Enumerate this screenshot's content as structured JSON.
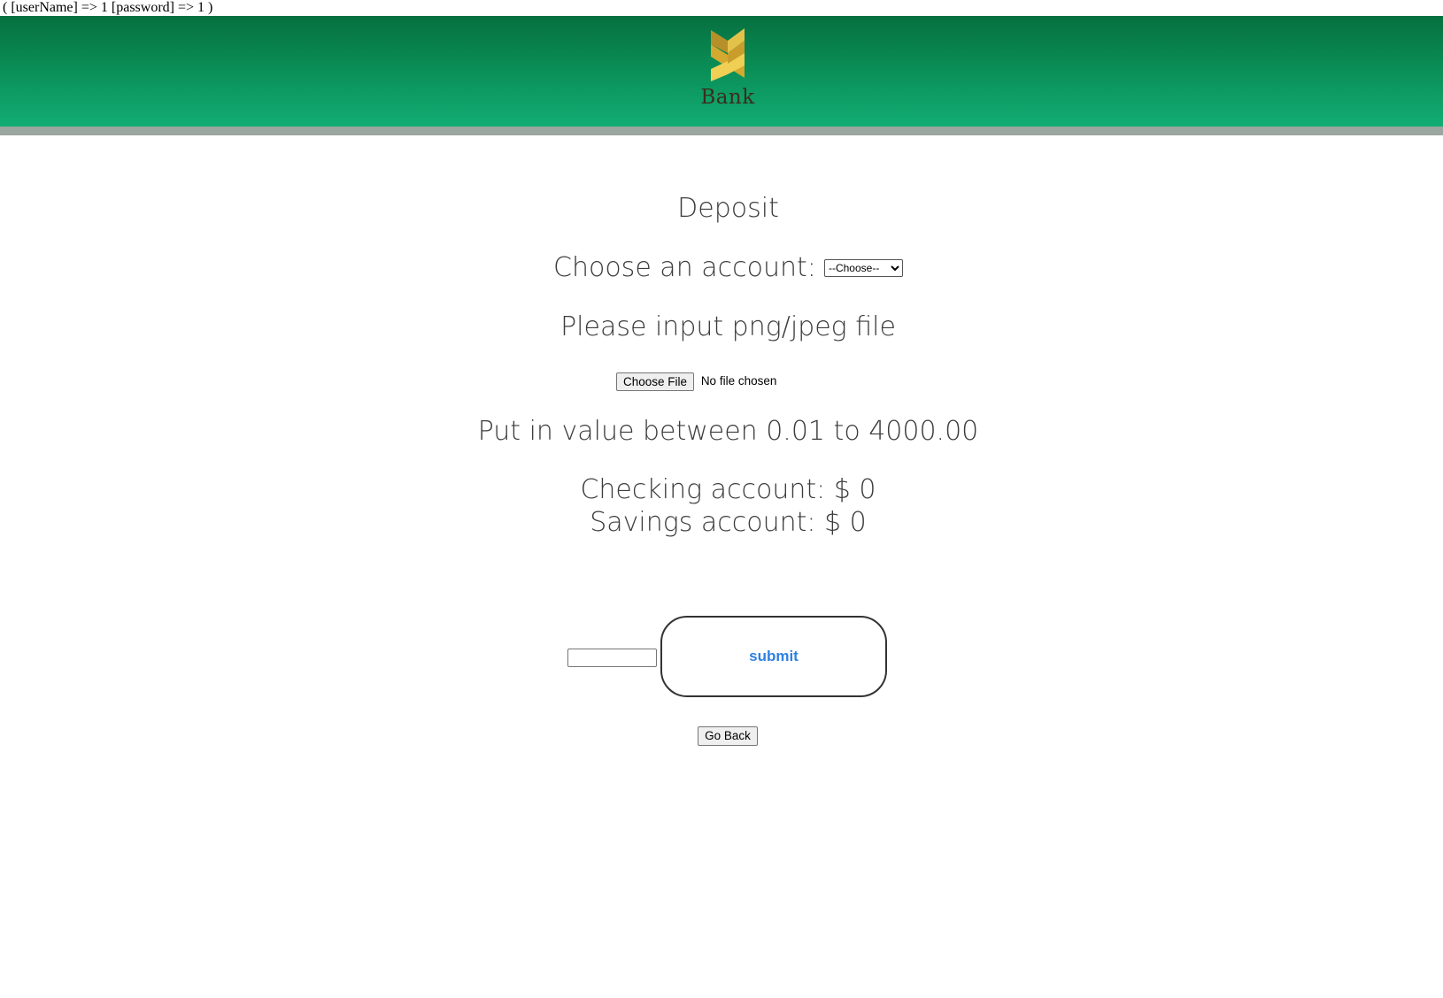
{
  "debug_output": "( [userName] => 1 [password] => 1 )",
  "header": {
    "logo_text": "Bank",
    "colors": {
      "banner_top": "#06703f",
      "banner_bottom": "#12ad74",
      "rule": "#9ca6a0",
      "logo_gold": "#d9b23a"
    }
  },
  "form": {
    "title": "Deposit",
    "account_label": "Choose an account:",
    "account_select": {
      "selected": "--Choose--",
      "options": [
        "--Choose--"
      ]
    },
    "file_prompt": "Please input png/jpeg file",
    "file_button_label": "Choose File",
    "file_status": "No file chosen",
    "range_prompt": "Put in value between 0.01 to 4000.00",
    "checking_balance": "Checking account: $ 0",
    "savings_balance": "Savings account: $ 0",
    "amount_value": "",
    "submit_label": "submit",
    "submit_color": "#2f81e0",
    "back_label": "Go Back"
  }
}
